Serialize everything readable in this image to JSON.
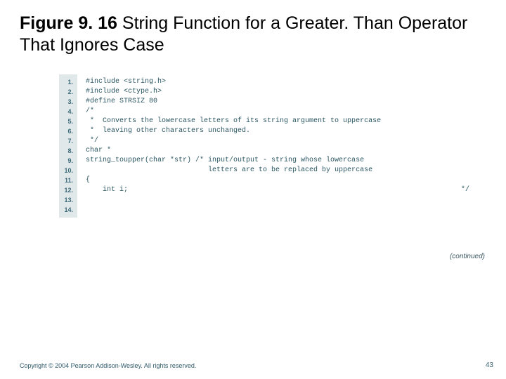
{
  "title": {
    "bold": "Figure 9. 16",
    "rest": "  String Function for a Greater. Than Operator That Ignores Case"
  },
  "code": {
    "numbers": [
      "1.",
      "2.",
      "3.",
      "4.",
      "5.",
      "6.",
      "7.",
      "8.",
      "9.",
      "10.",
      "11.",
      "12.",
      "13.",
      "14."
    ],
    "lines": [
      "#include <string.h>",
      "#include <ctype.h>",
      "",
      "#define STRSIZ 80",
      "",
      "/*",
      " *  Converts the lowercase letters of its string argument to uppercase",
      " *  leaving other characters unchanged.",
      " */",
      "char *",
      "string_toupper(char *str) /* input/output - string whose lowercase",
      "                             letters are to be replaced by uppercase",
      "{",
      "    int i;"
    ],
    "trailing_comment_end": "*/"
  },
  "continued": "(continued)",
  "footer": {
    "copyright": "Copyright © 2004 Pearson Addison-Wesley. All rights reserved.",
    "page": "43"
  }
}
